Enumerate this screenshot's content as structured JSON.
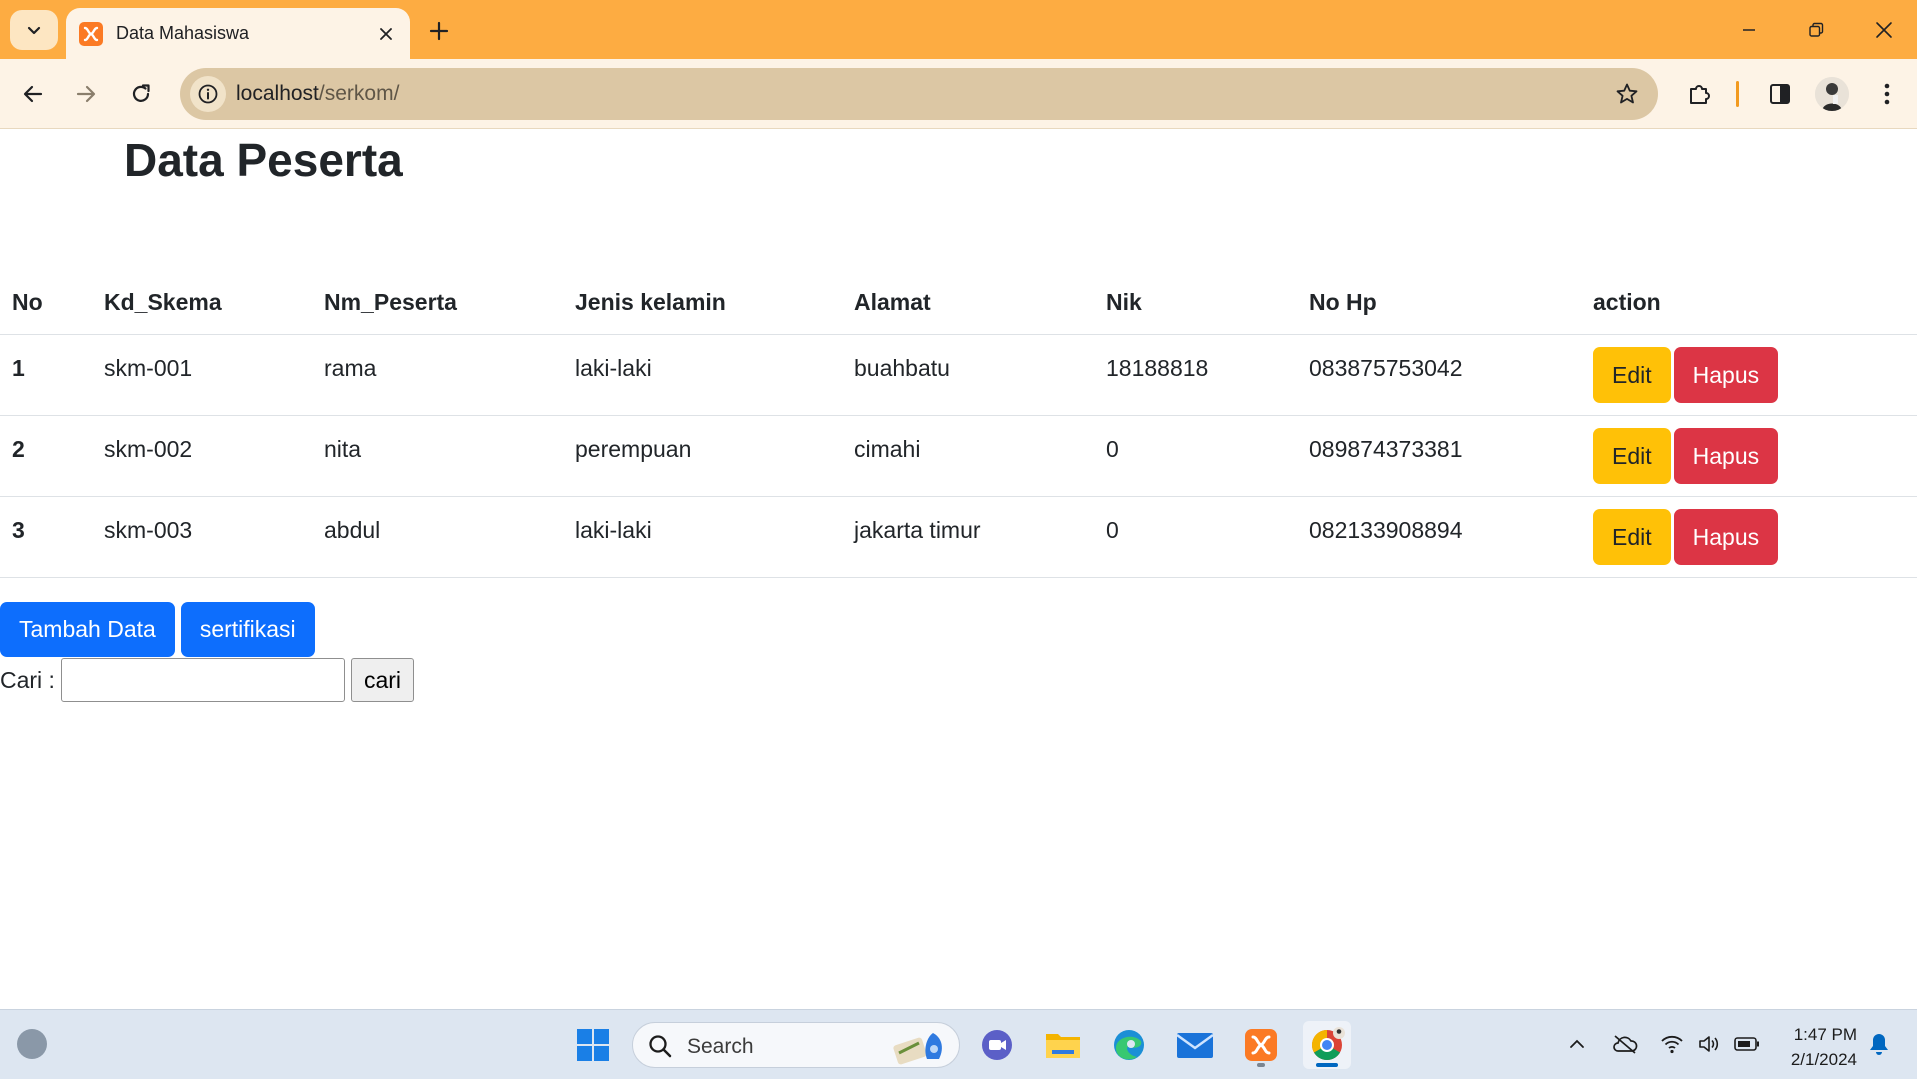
{
  "browser": {
    "tab_title": "Data Mahasiswa",
    "url_host": "localhost",
    "url_path": "/serkom/"
  },
  "page": {
    "title": "Data Peserta",
    "columns": [
      "No",
      "Kd_Skema",
      "Nm_Peserta",
      "Jenis kelamin",
      "Alamat",
      "Nik",
      "No Hp",
      "action"
    ],
    "rows": [
      {
        "no": "1",
        "kd_skema": "skm-001",
        "nm_peserta": "rama",
        "jenis_kelamin": "laki-laki",
        "alamat": "buahbatu",
        "nik": "18188818",
        "no_hp": "083875753042"
      },
      {
        "no": "2",
        "kd_skema": "skm-002",
        "nm_peserta": "nita",
        "jenis_kelamin": "perempuan",
        "alamat": "cimahi",
        "nik": "0",
        "no_hp": "089874373381"
      },
      {
        "no": "3",
        "kd_skema": "skm-003",
        "nm_peserta": "abdul",
        "jenis_kelamin": "laki-laki",
        "alamat": "jakarta timur",
        "nik": "0",
        "no_hp": "082133908894"
      }
    ],
    "edit_label": "Edit",
    "hapus_label": "Hapus",
    "tambah_label": "Tambah Data",
    "sertifikasi_label": "sertifikasi",
    "search_label": "Cari :",
    "search_value": "",
    "search_button": "cari"
  },
  "taskbar": {
    "search_placeholder": "Search",
    "time": "1:47 PM",
    "date": "2/1/2024"
  },
  "colors": {
    "chrome_titlebar": "#fdac42",
    "edit_button": "#ffc107",
    "hapus_button": "#dc3545",
    "primary_button": "#0d6efd"
  }
}
